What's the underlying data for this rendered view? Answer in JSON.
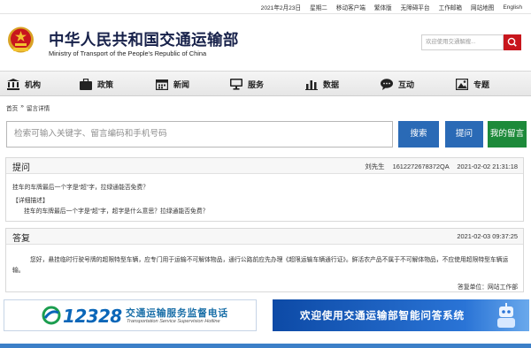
{
  "topbar": {
    "date": "2021年2月23日",
    "weekday": "星期二",
    "links": [
      "移动客户端",
      "繁体版",
      "无障碍平台",
      "工作邮箱",
      "网站地图"
    ],
    "current": "English"
  },
  "header": {
    "title": "中华人民共和国交通运输部",
    "subtitle": "Ministry of Transport of the People's Republic of China",
    "search_placeholder": "欢迎使用交通解搜..."
  },
  "nav": [
    {
      "label": "机构",
      "icon": "building-icon"
    },
    {
      "label": "政策",
      "icon": "briefcase-icon"
    },
    {
      "label": "新闻",
      "icon": "calendar-icon"
    },
    {
      "label": "服务",
      "icon": "monitor-icon"
    },
    {
      "label": "数据",
      "icon": "bar-chart-icon"
    },
    {
      "label": "互动",
      "icon": "chat-icon"
    },
    {
      "label": "专题",
      "icon": "image-icon"
    }
  ],
  "breadcrumb": {
    "home": "首页",
    "separator": "»",
    "current": "留言详情"
  },
  "query": {
    "placeholder": "检索可输入关键字、留言编码和手机号码",
    "search_label": "搜索",
    "ask_label": "提问",
    "mine_label": "我的留言"
  },
  "question": {
    "heading": "提问",
    "author": "刘先生",
    "code": "1612272678372QA",
    "datetime": "2021-02-02 21:31:18",
    "title": "挂车的车牌最后一个字是“超”字，拉绿通能否免费？",
    "detail_label": "【详细描述】",
    "detail": "挂车的车牌最后一个字是“超”字，超字是什么意思？拉绿通能否免费？"
  },
  "answer": {
    "heading": "答复",
    "datetime": "2021-02-03 09:37:25",
    "body": "您好，悬挂临时行驶号牌的超限特型车辆，应专门用于运输不可解体物品，通行公路前应先办理《超限运输车辆通行证》。鲜活农产品不属于不可解体物品，不应使用超限特型车辆运输。",
    "unit_label": "答复单位：",
    "unit": "网站工作部"
  },
  "banner1": {
    "number": "12328",
    "title": "交通运输服务监督电话",
    "subtitle": "Transportation Service Supervision Hotline"
  },
  "banner2": {
    "text": "欢迎使用交通运输部智能问答系统"
  },
  "colors": {
    "brand_red": "#c8161d",
    "primary_blue": "#2a6ab6",
    "green": "#1d8a3a",
    "title_navy": "#17214a"
  }
}
